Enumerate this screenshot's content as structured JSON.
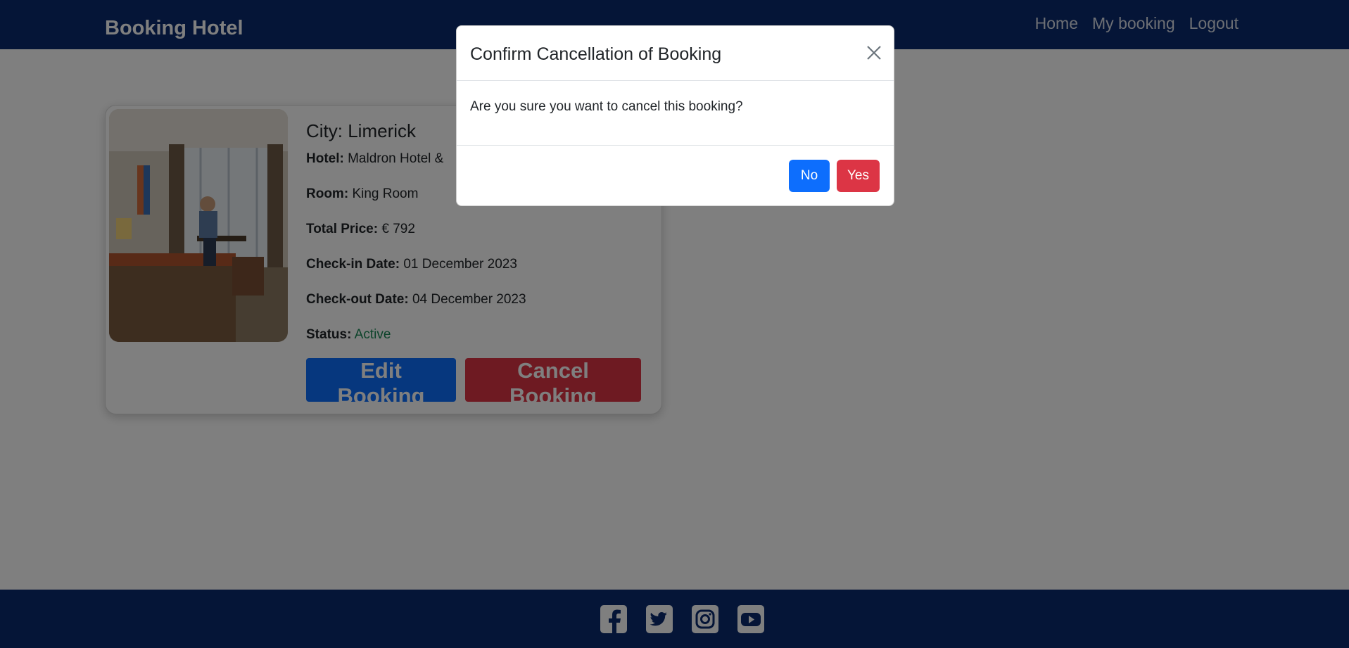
{
  "navbar": {
    "brand": "Booking Hotel",
    "links": [
      "Home",
      "My booking",
      "Logout"
    ]
  },
  "booking": {
    "city_label": "City: Limerick",
    "hotel_key": "Hotel:",
    "hotel_value": "Maldron Hotel &",
    "room_key": "Room:",
    "room_value": "King Room",
    "price_key": "Total Price:",
    "price_value": "€ 792",
    "checkin_key": "Check-in Date:",
    "checkin_value": "01 December 2023",
    "checkout_key": "Check-out Date:",
    "checkout_value": "04 December 2023",
    "status_key": "Status:",
    "status_value": "Active",
    "edit_label": "Edit Booking",
    "cancel_label": "Cancel Booking"
  },
  "modal": {
    "title": "Confirm Cancellation of Booking",
    "message": "Are you sure you want to cancel this booking?",
    "no_label": "No",
    "yes_label": "Yes"
  },
  "footer": {
    "icons": [
      "facebook-icon",
      "twitter-icon",
      "instagram-icon",
      "youtube-icon"
    ]
  },
  "colors": {
    "navbar": "#0a2a6e",
    "primary": "#0d6efd",
    "danger": "#dc3545",
    "success": "#198754"
  }
}
